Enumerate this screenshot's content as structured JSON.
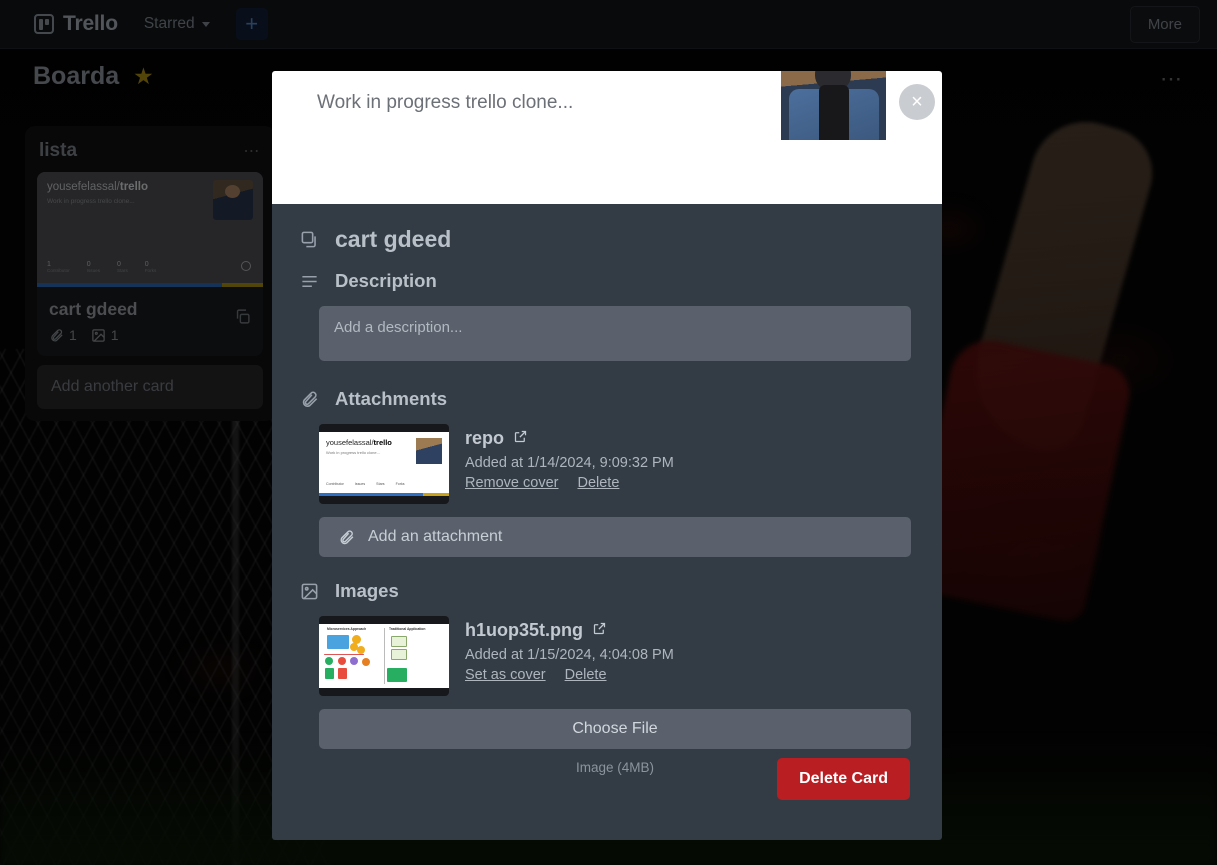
{
  "topnav": {
    "brand": "Trello",
    "starred_label": "Starred",
    "add_label": "+",
    "more_label": "More"
  },
  "board": {
    "title": "Boarda",
    "star_icon": "star-icon",
    "menu_icon": "board-menu-icon",
    "list": {
      "name": "lista",
      "menu_icon": "list-menu-icon",
      "card": {
        "title": "cart gdeed",
        "attachment_count": "1",
        "image_count": "1",
        "cover": {
          "repo_owner": "yousefelassal/",
          "repo_name": "trello",
          "repo_desc": "Work in progress trello clone...",
          "stats": [
            {
              "value": "1",
              "label": "Contributor"
            },
            {
              "value": "0",
              "label": "Issues"
            },
            {
              "value": "0",
              "label": "Stars"
            },
            {
              "value": "0",
              "label": "Forks"
            }
          ]
        }
      },
      "add_card_label": "Add another card"
    }
  },
  "modal": {
    "cover_text": "Work in progress trello clone...",
    "close_label": "×",
    "card_title": "cart gdeed",
    "description": {
      "heading": "Description",
      "placeholder": "Add a description...",
      "value": ""
    },
    "attachments": {
      "heading": "Attachments",
      "items": [
        {
          "name": "repo",
          "added": "Added at 1/14/2024, 9:09:32 PM",
          "action_cover": "Remove cover",
          "action_delete": "Delete",
          "thumb_repo_owner": "yousefelassal/",
          "thumb_repo_name": "trello",
          "thumb_repo_desc": "Work in progress trello clone...",
          "thumb_stats": [
            "Contributor",
            "Issues",
            "Stars",
            "Forks"
          ]
        }
      ],
      "add_label": "Add an attachment"
    },
    "images": {
      "heading": "Images",
      "items": [
        {
          "name": "h1uop35t.png",
          "added": "Added at 1/15/2024, 4:04:08 PM",
          "action_cover": "Set as cover",
          "action_delete": "Delete",
          "thumb_left_title": "Microservices Approach",
          "thumb_right_title": "Traditional Application"
        }
      ],
      "choose_file_label": "Choose File",
      "file_hint": "Image (4MB)"
    },
    "delete_card_label": "Delete Card"
  },
  "colors": {
    "modal_bg": "#333b45",
    "field_bg": "#5a616c",
    "danger": "#b81e22",
    "accent_blue": "#2f6fc4",
    "star": "#b89a18"
  }
}
